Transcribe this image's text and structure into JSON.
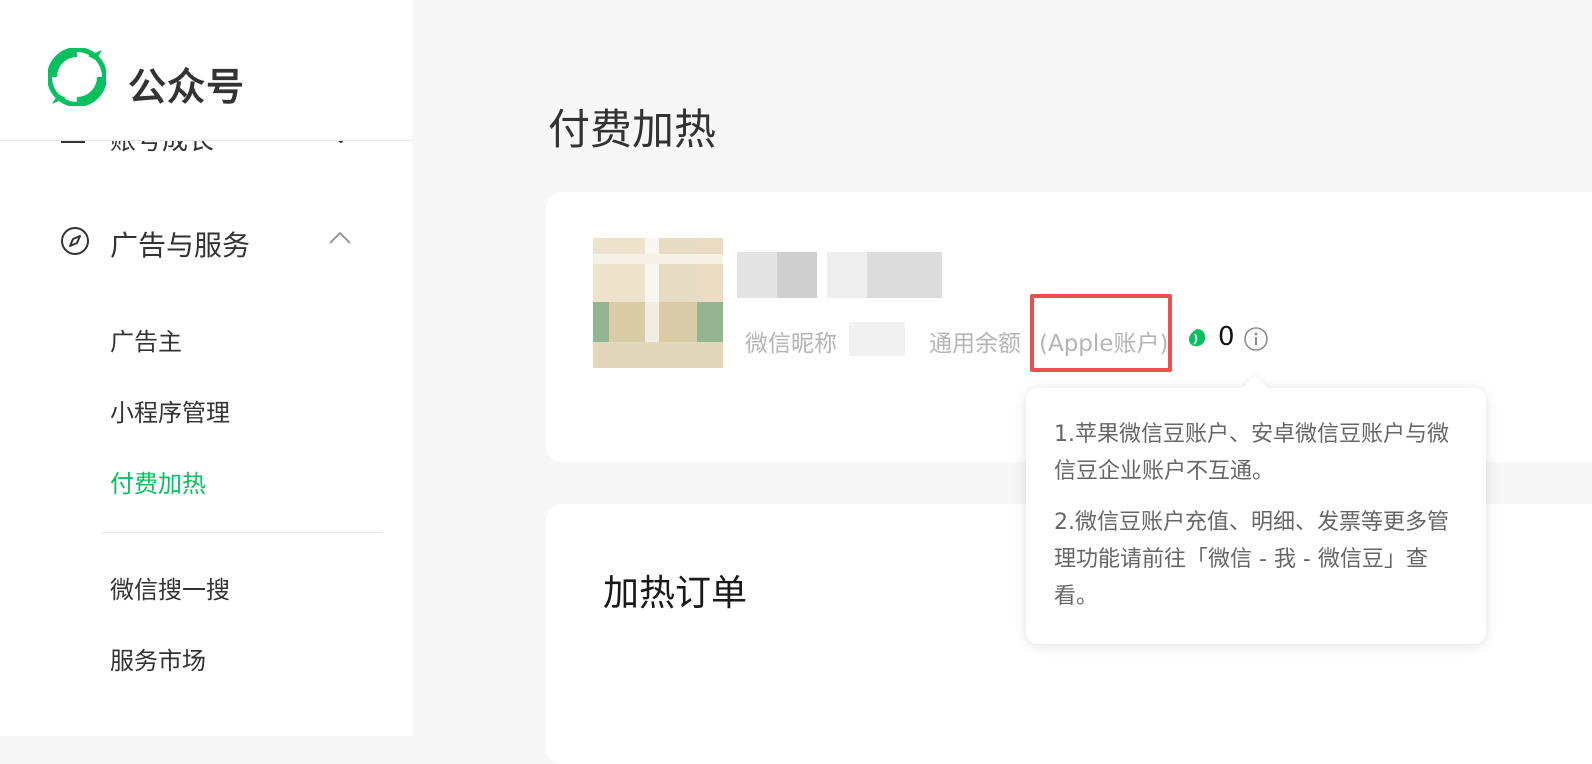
{
  "brand": {
    "name": "公众号",
    "logo_icon": "wechat-logo-icon",
    "accent_color": "#07c160"
  },
  "sidebar": {
    "cut_item": {
      "label": "账号成长",
      "icon": "growth-icon"
    },
    "section": {
      "label": "广告与服务",
      "icon": "compass-icon",
      "chevron": "chevron-up-icon"
    },
    "items": [
      {
        "label": "广告主",
        "active": false
      },
      {
        "label": "小程序管理",
        "active": false
      },
      {
        "label": "付费加热",
        "active": true
      },
      {
        "label": "微信搜一搜",
        "active": false
      },
      {
        "label": "服务市场",
        "active": false
      }
    ]
  },
  "page": {
    "title": "付费加热"
  },
  "account": {
    "nickname_label": "微信昵称",
    "balance_label": "通用余额",
    "account_type": "(Apple账户)",
    "balance_value": "0",
    "highlight_color": "#ee4e4e"
  },
  "tooltip": {
    "line1": "1.苹果微信豆账户、安卓微信豆账户与微信豆企业账户不互通。",
    "line2": "2.微信豆账户充值、明细、发票等更多管理功能请前往「微信 - 我 - 微信豆」查看。"
  },
  "orders": {
    "title": "加热订单"
  }
}
